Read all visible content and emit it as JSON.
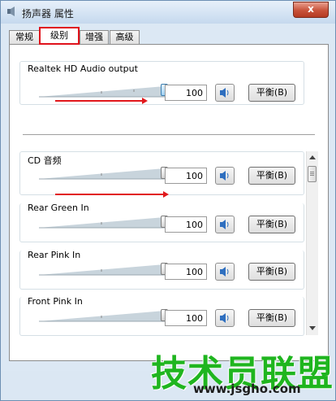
{
  "window": {
    "title": "扬声器 属性",
    "close_label": "x"
  },
  "tabs": [
    {
      "label": "常规"
    },
    {
      "label": "级别"
    },
    {
      "label": "增强"
    },
    {
      "label": "高级"
    }
  ],
  "active_tab": "级别",
  "devices": [
    {
      "label": "Realtek HD Audio output",
      "level": "100",
      "balance_label": "平衡(B)",
      "slider_fraction": 1.0
    },
    {
      "label": "CD 音频",
      "level": "100",
      "balance_label": "平衡(B)",
      "slider_fraction": 1.0
    },
    {
      "label": "Rear Green In",
      "level": "100",
      "balance_label": "平衡(B)",
      "slider_fraction": 1.0
    },
    {
      "label": "Rear Pink In",
      "level": "100",
      "balance_label": "平衡(B)",
      "slider_fraction": 1.0
    },
    {
      "label": "Front Pink In",
      "level": "100",
      "balance_label": "平衡(B)",
      "slider_fraction": 1.0
    }
  ],
  "watermark": {
    "brand": "技术员联盟",
    "url": "www.jsgho.com"
  },
  "colors": {
    "highlight_red": "#e1181c",
    "watermark_green": "#1fb51f"
  }
}
